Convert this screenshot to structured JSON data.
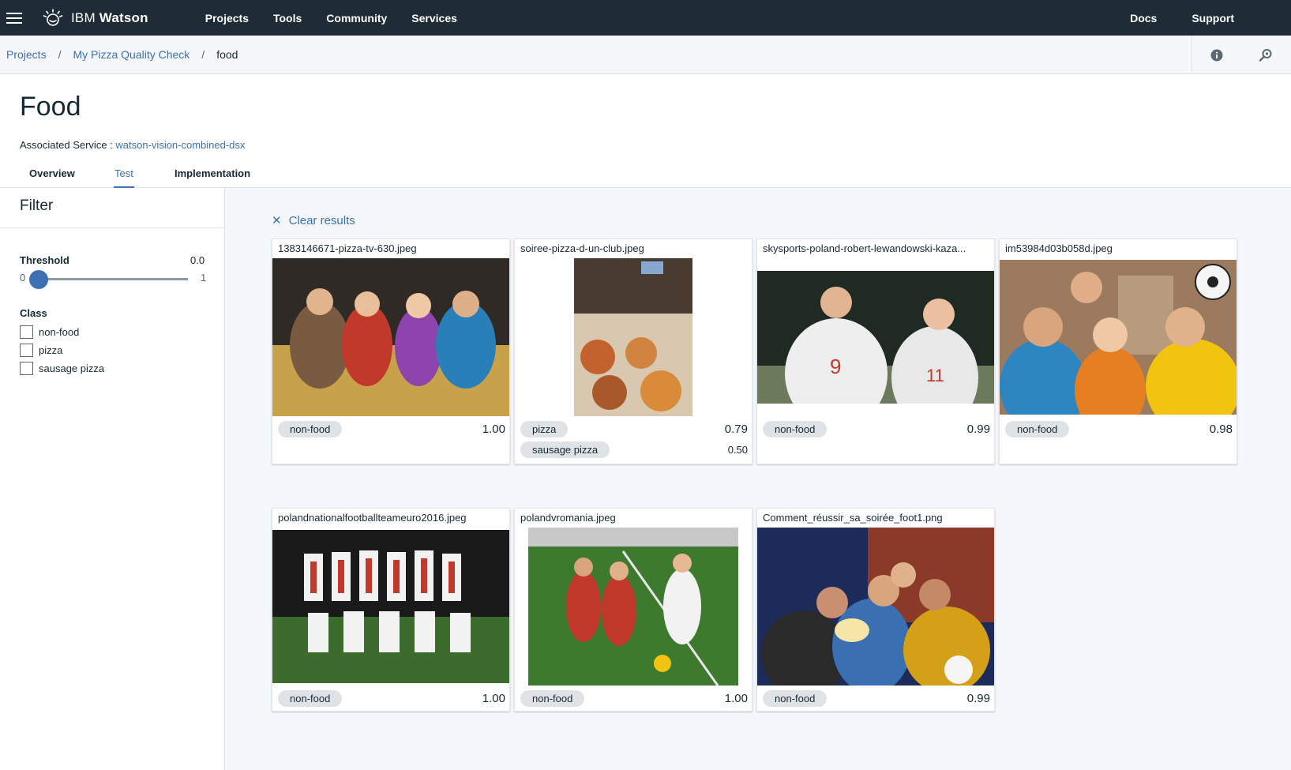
{
  "topbar": {
    "brand_prefix": "IBM",
    "brand_name": "Watson",
    "nav": [
      "Projects",
      "Tools",
      "Community",
      "Services"
    ],
    "right": [
      "Docs",
      "Support"
    ]
  },
  "breadcrumb": {
    "items": [
      "Projects",
      "My Pizza Quality Check"
    ],
    "current": "food"
  },
  "page": {
    "title": "Food",
    "assoc_label": "Associated Service :",
    "assoc_service": "watson-vision-combined-dsx",
    "tabs": [
      "Overview",
      "Test",
      "Implementation"
    ],
    "active_tab": "Test"
  },
  "filter": {
    "title": "Filter",
    "threshold_label": "Threshold",
    "threshold_value": "0.0",
    "slider_min": "0",
    "slider_max": "1",
    "class_label": "Class",
    "classes": [
      "non-food",
      "pizza",
      "sausage pizza"
    ]
  },
  "results": {
    "clear_label": "Clear results",
    "cards": [
      {
        "filename": "1383146671-pizza-tv-630.jpeg",
        "tags": [
          {
            "label": "non-food",
            "score": "1.00"
          }
        ],
        "colors": [
          "#3a3028",
          "#7a5a40",
          "#c0392b",
          "#2980b9"
        ]
      },
      {
        "filename": "soiree-pizza-d-un-club.jpeg",
        "tags": [
          {
            "label": "pizza",
            "score": "0.79"
          },
          {
            "label": "sausage pizza",
            "score": "0.50"
          }
        ],
        "colors": [
          "#4a3b30",
          "#d9c8b0",
          "#c1622f",
          "#8a5a3a"
        ]
      },
      {
        "filename": "skysports-poland-robert-lewandowski-kaza...",
        "tags": [
          {
            "label": "non-food",
            "score": "0.99"
          }
        ],
        "colors": [
          "#1e2a22",
          "#e8e8e8",
          "#c0392b",
          "#6b7a5a"
        ]
      },
      {
        "filename": "im53984d03b058d.jpeg",
        "tags": [
          {
            "label": "non-food",
            "score": "0.98"
          }
        ],
        "colors": [
          "#9c7a5e",
          "#2e86c1",
          "#e67e22",
          "#f1c40f"
        ]
      },
      {
        "filename": "polandnationalfootballteameuro2016.jpeg",
        "tags": [
          {
            "label": "non-food",
            "score": "1.00"
          }
        ],
        "colors": [
          "#1a1a1a",
          "#f2f2f2",
          "#c0392b",
          "#3d6b2e"
        ]
      },
      {
        "filename": "polandvromania.jpeg",
        "tags": [
          {
            "label": "non-food",
            "score": "1.00"
          }
        ],
        "colors": [
          "#3d7a2e",
          "#c0392b",
          "#f2f2f2",
          "#2e5a22"
        ]
      },
      {
        "filename": "Comment_réussir_sa_soirée_foot1.png",
        "tags": [
          {
            "label": "non-food",
            "score": "0.99"
          }
        ],
        "colors": [
          "#1c2b5a",
          "#8b3a2a",
          "#3a6fb2",
          "#d4a017"
        ]
      }
    ]
  }
}
